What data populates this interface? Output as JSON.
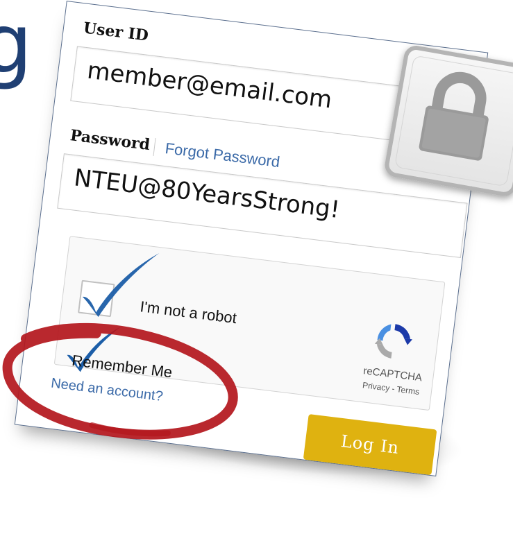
{
  "background_letter": "g",
  "login": {
    "user_id_label": "User ID",
    "user_id_value": "member@email.com",
    "password_label": "Password",
    "forgot_password_link": "Forgot Password",
    "password_value": "NTEU@80YearsStrong!",
    "captcha": {
      "checkbox_label": "I'm not a robot",
      "checked": true,
      "brand": "reCAPTCHA",
      "privacy_link": "Privacy",
      "link_separator": " - ",
      "terms_link": "Terms"
    },
    "remember_me_label": "Remember Me",
    "remember_me_checked": true,
    "need_account_link": "Need an account?",
    "login_button": "Log In"
  },
  "icons": {
    "lock": "padlock-icon",
    "captcha_logo": "recaptcha-logo-icon",
    "check": "blue-checkmark-icon"
  },
  "colors": {
    "heading_blue": "#1f3f73",
    "link_blue": "#3b6aa8",
    "button_gold": "#dfb210",
    "annotation_red": "#b3161c",
    "check_blue": "#1c5ea8"
  }
}
